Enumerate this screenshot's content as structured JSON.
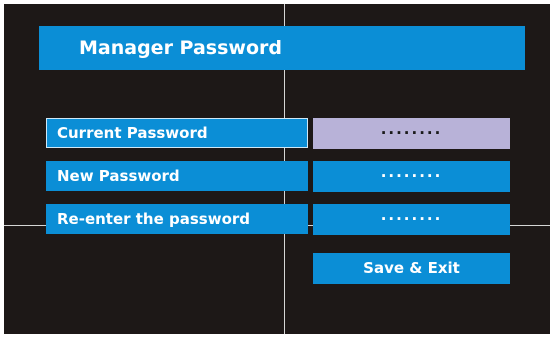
{
  "dialog": {
    "title": "Manager Password"
  },
  "fields": [
    {
      "label": "Current Password",
      "value": "········"
    },
    {
      "label": "New Password",
      "value": "········"
    },
    {
      "label": "Re-enter the password",
      "value": "········"
    }
  ],
  "actions": {
    "save_label": "Save & Exit"
  },
  "colors": {
    "background": "#1d1817",
    "accent": "#0b8ed6",
    "active_field": "#b8b2d8",
    "crosshair": "#d6d6d6"
  }
}
